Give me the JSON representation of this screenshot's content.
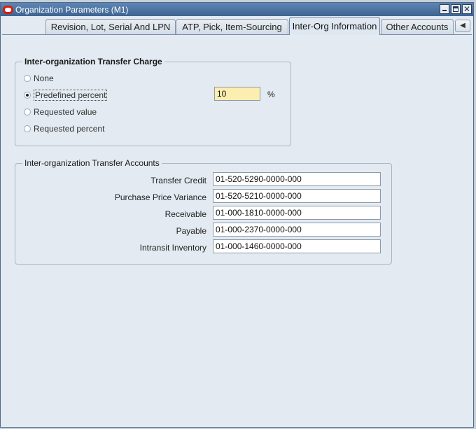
{
  "window": {
    "title": "Organization Parameters (M1)",
    "controls": {
      "minimize": "▁",
      "maximize": "□",
      "close": "✕"
    }
  },
  "tabs": [
    {
      "label": "Revision, Lot, Serial And LPN"
    },
    {
      "label": "ATP, Pick, Item-Sourcing"
    },
    {
      "label": "Inter-Org Information"
    },
    {
      "label": "Other Accounts"
    }
  ],
  "active_tab": "Inter-Org Information",
  "transfer_charge": {
    "heading": "Inter-organization Transfer Charge",
    "options": [
      {
        "label": "None",
        "selected": false
      },
      {
        "label": "Predefined percent",
        "selected": true
      },
      {
        "label": "Requested value",
        "selected": false
      },
      {
        "label": "Requested percent",
        "selected": false
      }
    ],
    "percent_value": "10",
    "percent_unit": "%"
  },
  "transfer_accounts": {
    "heading": "Inter-organization Transfer Accounts",
    "fields": [
      {
        "label": "Transfer Credit",
        "value": "01-520-5290-0000-000"
      },
      {
        "label": "Purchase Price Variance",
        "value": "01-520-5210-0000-000"
      },
      {
        "label": "Receivable",
        "value": "01-000-1810-0000-000"
      },
      {
        "label": "Payable",
        "value": "01-000-2370-0000-000"
      },
      {
        "label": "Intransit Inventory",
        "value": "01-000-1460-0000-000"
      }
    ]
  },
  "colors": {
    "titlebar": "#3e6391",
    "background": "#e3eaf1",
    "required_field": "#fceeb0"
  }
}
